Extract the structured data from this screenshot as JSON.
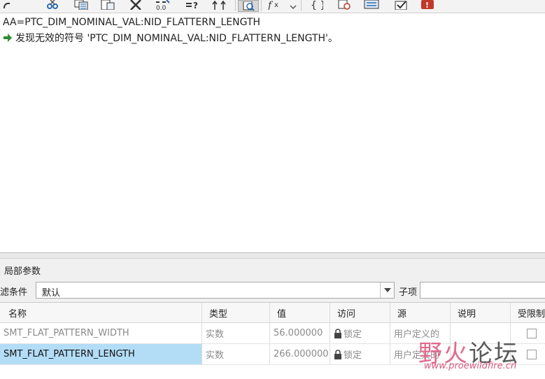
{
  "toolbar": {
    "icons": [
      "redo-icon",
      "cut-icon",
      "copy-icon",
      "paste-icon",
      "delete-icon",
      "format-number-icon",
      "insert-relation-icon",
      "sort-icon",
      "verify-icon",
      "function-icon",
      "braces-icon",
      "evaluate-icon",
      "display-icon",
      "check-icon",
      "error-icon"
    ]
  },
  "editor": {
    "line1": "AA=PTC_DIM_NOMINAL_VAL:NID_FLATTERN_LENGTH",
    "line2": "发现无效的符号 'PTC_DIM_NOMINAL_VAL:NID_FLATTERN_LENGTH'。"
  },
  "panel": {
    "title": "局部参数",
    "filter_label": "滤条件",
    "filter_value": "默认",
    "sub_label": "子项"
  },
  "table": {
    "headers": [
      "名称",
      "类型",
      "值",
      "访问",
      "源",
      "说明",
      "受限制"
    ],
    "rows": [
      {
        "name": "SMT_FLAT_PATTERN_WIDTH",
        "type": "实数",
        "value": "56.000000",
        "access": "锁定",
        "source": "用户定义的"
      },
      {
        "name": "SMT_FLAT_PATTERN_LENGTH",
        "type": "实数",
        "value": "266.000000",
        "access": "锁定",
        "source": "用户定义的"
      }
    ]
  },
  "watermark": {
    "title_1": "野",
    "title_2": "火",
    "title_3": "论坛",
    "url": "www.proewildfire.cn"
  },
  "colors": {
    "selected_row": "#b3ddf7",
    "watermark_pink": "#e06a8c",
    "error_red": "#c0392b"
  }
}
